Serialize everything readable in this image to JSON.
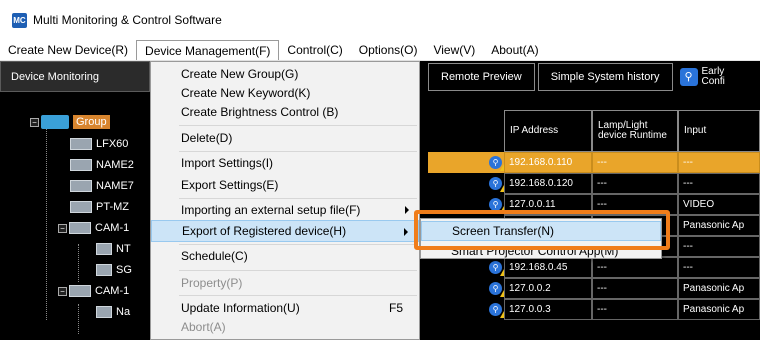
{
  "window": {
    "title": "Multi Monitoring & Control Software",
    "icon": "app-icon"
  },
  "menubar": [
    {
      "label": "Create New Device(R)"
    },
    {
      "label": "Device Management(F)",
      "open": true
    },
    {
      "label": "Control(C)"
    },
    {
      "label": "Options(O)"
    },
    {
      "label": "View(V)"
    },
    {
      "label": "About(A)"
    }
  ],
  "left_tab": "Device Monitoring",
  "top_tabs": [
    "Remote Preview",
    "Simple System history"
  ],
  "early_tab": {
    "line1": "Early",
    "line2": "Confi"
  },
  "tree": {
    "items": [
      {
        "label": "Group"
      },
      {
        "label": "LFX60"
      },
      {
        "label": "NAME2"
      },
      {
        "label": "NAME7"
      },
      {
        "label": "PT-MZ"
      },
      {
        "label": "CAM-1"
      },
      {
        "label": "NT"
      },
      {
        "label": "SG"
      },
      {
        "label": "CAM-1"
      },
      {
        "label": "Na"
      }
    ]
  },
  "table": {
    "headers": [
      "IP Address",
      "Lamp/Light device Runtime",
      "Input"
    ],
    "rows": [
      {
        "ip": "192.168.0.110",
        "runtime": "---",
        "input": "---",
        "selected": true
      },
      {
        "ip": "192.168.0.120",
        "runtime": "---",
        "input": "---"
      },
      {
        "ip": "127.0.0.11",
        "runtime": "---",
        "input": "VIDEO"
      },
      {
        "ip": "",
        "runtime": "---",
        "input": "Panasonic Ap"
      },
      {
        "ip": "",
        "runtime": "",
        "input": "---"
      },
      {
        "ip": "192.168.0.45",
        "runtime": "---",
        "input": "---"
      },
      {
        "ip": "127.0.0.2",
        "runtime": "---",
        "input": "Panasonic Ap"
      },
      {
        "ip": "127.0.0.3",
        "runtime": "---",
        "input": "Panasonic Ap"
      }
    ]
  },
  "dropdown": {
    "items": [
      {
        "label": "Create New Group(G)"
      },
      {
        "label": "Create New Keyword(K)"
      },
      {
        "label": "Create Brightness Control (B)"
      },
      {
        "label": "Delete(D)"
      },
      {
        "label": "Import Settings(I)"
      },
      {
        "label": "Export Settings(E)"
      },
      {
        "label": "Importing an external setup file(F)",
        "submenu": true
      },
      {
        "label": "Export of Registered device(H)",
        "submenu": true,
        "hover": true
      },
      {
        "label": "Schedule(C)"
      },
      {
        "label": "Property(P)",
        "disabled": true
      },
      {
        "label": "Update Information(U)",
        "shortcut": "F5"
      },
      {
        "label": "Abort(A)",
        "disabled": true
      }
    ]
  },
  "submenu": {
    "items": [
      {
        "label": "Screen Transfer(N)",
        "hover": true
      },
      {
        "label": "Smart Projector Control App(M)"
      }
    ]
  },
  "colors": {
    "highlight": "#f07d1a",
    "selected_row": "#e9a52a",
    "menu_hover": "#cce4f7",
    "status_icon": "#2a73d9"
  }
}
